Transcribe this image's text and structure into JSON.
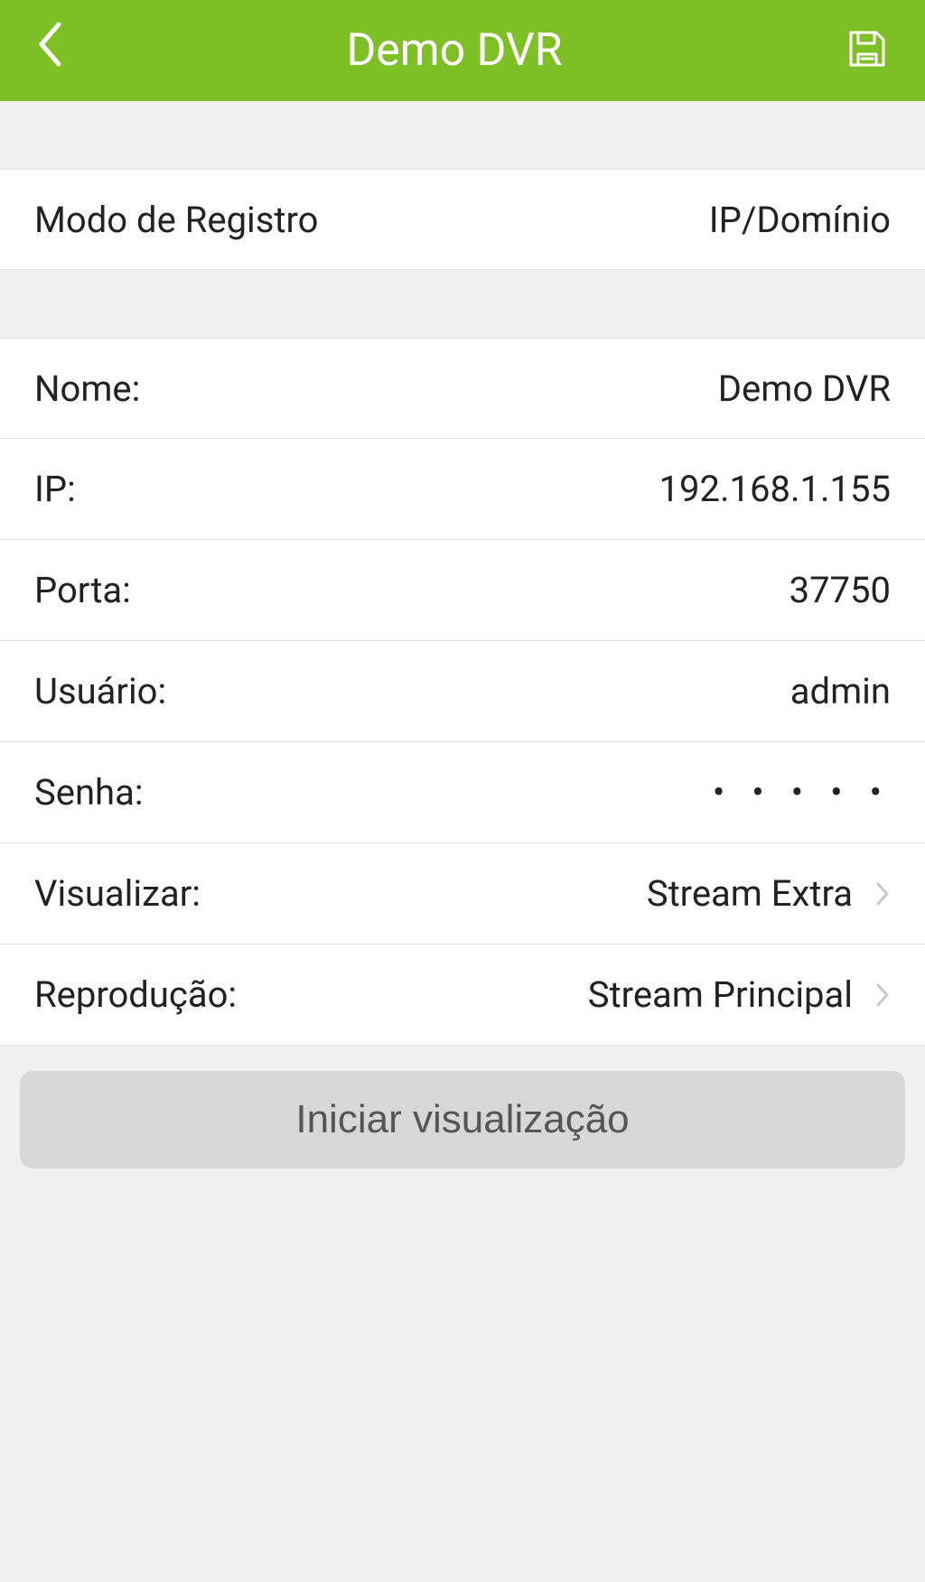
{
  "header": {
    "title": "Demo DVR"
  },
  "rows": {
    "registerMode": {
      "label": "Modo de Registro",
      "value": "IP/Domínio"
    },
    "name": {
      "label": "Nome:",
      "value": "Demo DVR"
    },
    "ip": {
      "label": "IP:",
      "value": "192.168.1.155"
    },
    "port": {
      "label": "Porta:",
      "value": "37750"
    },
    "user": {
      "label": "Usuário:",
      "value": "admin"
    },
    "password": {
      "label": "Senha:",
      "value": "●●●●●"
    },
    "view": {
      "label": "Visualizar:",
      "value": "Stream Extra"
    },
    "playback": {
      "label": "Reprodução:",
      "value": "Stream Principal"
    }
  },
  "button": {
    "start": "Iniciar visualização"
  }
}
